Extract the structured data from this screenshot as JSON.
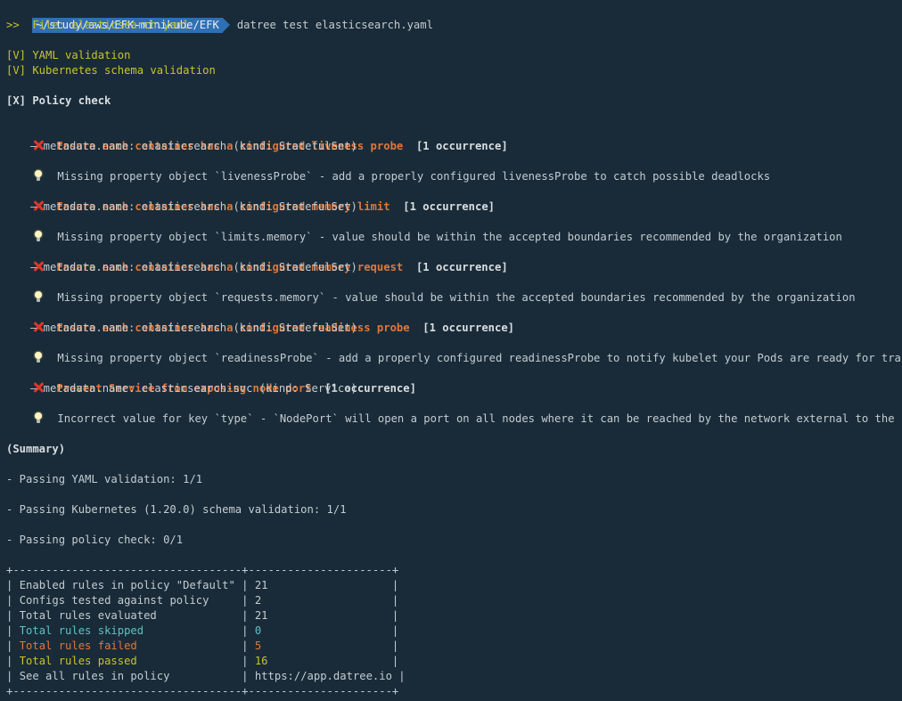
{
  "prompt": {
    "path": "~/study/aws/EFK-minikube/EFK",
    "command": "datree test elasticsearch.yaml"
  },
  "file_line": ">>  File: elasticsearch.yaml",
  "checks": {
    "yaml": "[V] YAML validation",
    "k8s": "[V] Kubernetes schema validation",
    "policy": "[X] Policy check"
  },
  "violations": [
    {
      "title": "Ensure each container has a configured liveness probe",
      "count": "[1 occurrence]",
      "meta": "— metadata.name: elasticsearch (kind: StatefulSet)",
      "hint": "Missing property object `livenessProbe` - add a properly configured livenessProbe to catch possible deadlocks"
    },
    {
      "title": "Ensure each container has a configured memory limit",
      "count": "[1 occurrence]",
      "meta": "— metadata.name: elasticsearch (kind: StatefulSet)",
      "hint": "Missing property object `limits.memory` - value should be within the accepted boundaries recommended by the organization"
    },
    {
      "title": "Ensure each container has a configured memory request",
      "count": "[1 occurrence]",
      "meta": "— metadata.name: elasticsearch (kind: StatefulSet)",
      "hint": "Missing property object `requests.memory` - value should be within the accepted boundaries recommended by the organization"
    },
    {
      "title": "Ensure each container has a configured readiness probe",
      "count": "[1 occurrence]",
      "meta": "— metadata.name: elasticsearch (kind: StatefulSet)",
      "hint": "Missing property object `readinessProbe` - add a properly configured readinessProbe to notify kubelet your Pods are ready for traffic"
    },
    {
      "title": "Prevent Service from exposing node port",
      "count": "[1 occurrence]",
      "meta": "— metadata.name: elasticsearch-svc (kind: Service)",
      "hint": "Incorrect value for key `type` - `NodePort` will open a port on all nodes where it can be reached by the network external to the cluster"
    }
  ],
  "summary": {
    "heading": "(Summary)",
    "yaml": "- Passing YAML validation: 1/1",
    "k8s": "- Passing Kubernetes (1.20.0) schema validation: 1/1",
    "policy": "- Passing policy check: 0/1"
  },
  "table": {
    "border": "+-----------------------------------+----------------------+",
    "rows": [
      {
        "label": "Enabled rules in policy \"Default\"",
        "value": "21",
        "color": "default"
      },
      {
        "label": "Configs tested against policy",
        "value": "2",
        "color": "default"
      },
      {
        "label": "Total rules evaluated",
        "value": "21",
        "color": "default"
      },
      {
        "label": "Total rules skipped",
        "value": "0",
        "color": "teal"
      },
      {
        "label": "Total rules failed",
        "value": "5",
        "color": "orange"
      },
      {
        "label": "Total rules passed",
        "value": "16",
        "color": "yellow"
      },
      {
        "label": "See all rules in policy",
        "value": "https://app.datree.io",
        "color": "default"
      }
    ]
  },
  "colors": {
    "background": "#192b38",
    "prompt_bg": "#2f6fb6",
    "yellow": "#c9c42a",
    "orange": "#e0773a",
    "teal": "#5fc1c4",
    "error_red": "#e0362b"
  },
  "icons": {
    "error": "x-icon",
    "hint": "bulb-icon"
  }
}
